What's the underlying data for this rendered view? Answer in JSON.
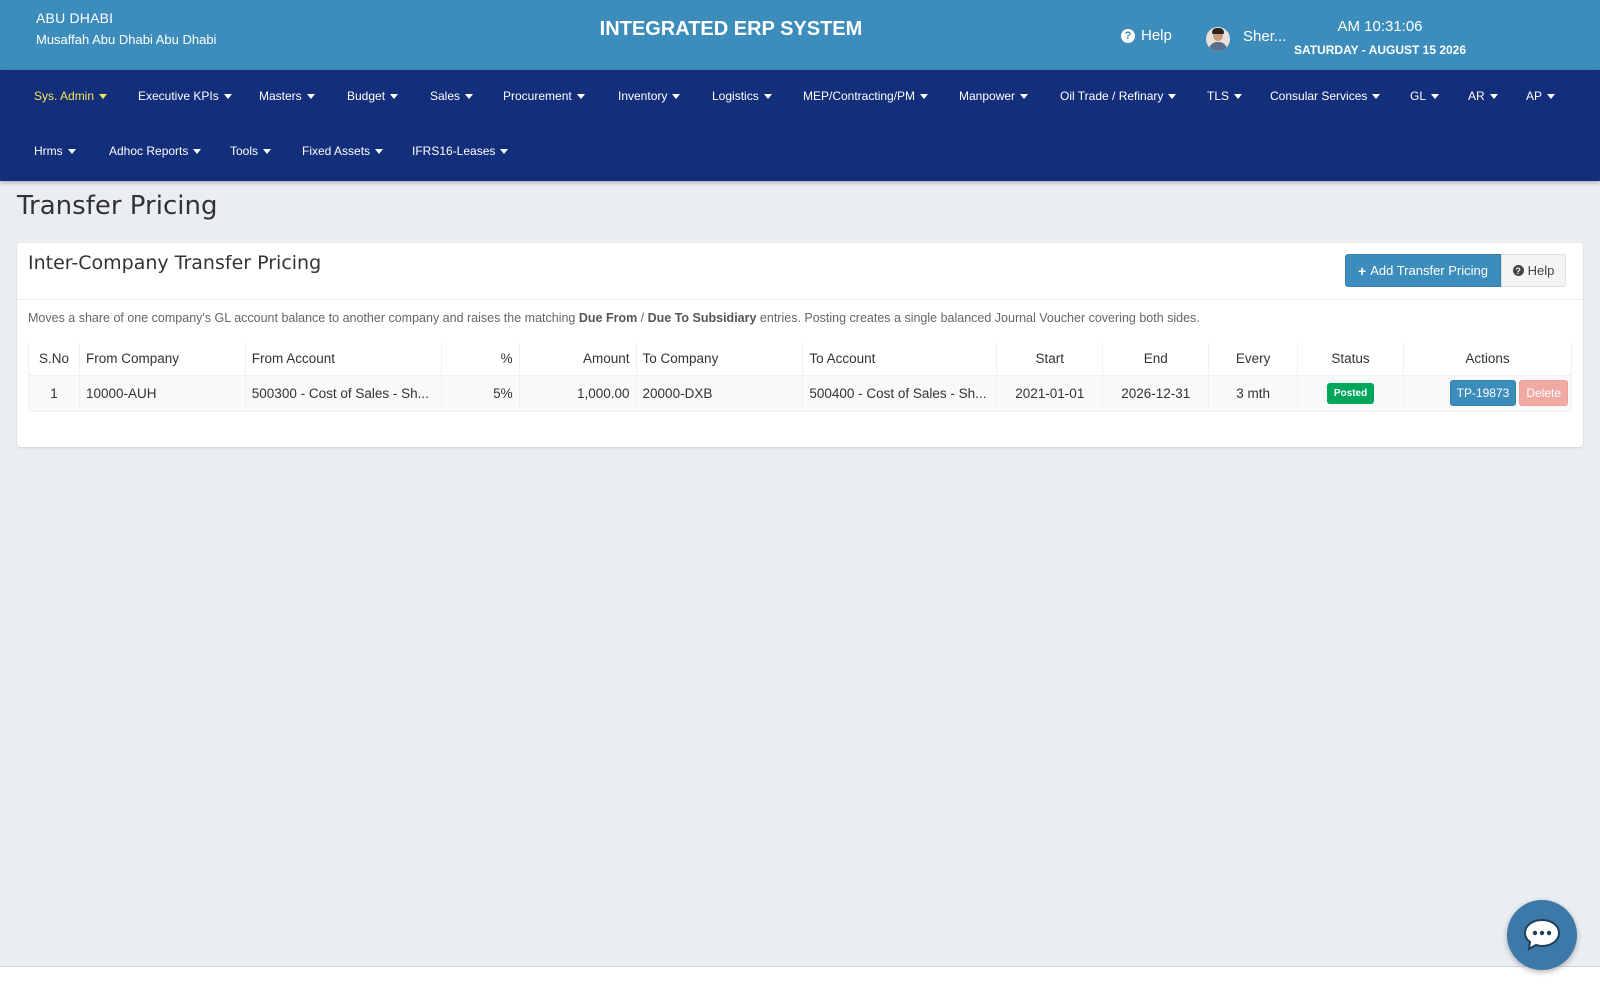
{
  "header": {
    "org_name": "ABU DHABI",
    "org_address": "Musaffah Abu Dhabi Abu Dhabi",
    "system_title": "INTEGRATED ERP SYSTEM",
    "help_label": "Help",
    "user_name": "Sher...",
    "clock_time": "AM 10:31:06",
    "clock_date": "SATURDAY - AUGUST 15 2026"
  },
  "nav": {
    "items": [
      {
        "label": "Sys. Admin",
        "active": true
      },
      {
        "label": "Executive KPIs"
      },
      {
        "label": "Masters"
      },
      {
        "label": "Budget"
      },
      {
        "label": "Sales"
      },
      {
        "label": "Procurement"
      },
      {
        "label": "Inventory"
      },
      {
        "label": "Logistics"
      },
      {
        "label": "MEP/Contracting/PM"
      },
      {
        "label": "Manpower"
      },
      {
        "label": "Oil Trade / Refinary"
      },
      {
        "label": "TLS"
      },
      {
        "label": "Consular Services"
      },
      {
        "label": "GL"
      },
      {
        "label": "AR"
      },
      {
        "label": "AP"
      },
      {
        "label": "Hrms"
      },
      {
        "label": "Adhoc Reports"
      },
      {
        "label": "Tools"
      },
      {
        "label": "Fixed Assets"
      },
      {
        "label": "IFRS16-Leases"
      }
    ]
  },
  "page": {
    "title": "Transfer Pricing",
    "card_title": "Inter-Company Transfer Pricing",
    "add_button_label": "Add Transfer Pricing",
    "help_button_label": "Help",
    "description": {
      "prefix": "Moves a share of one company's GL account balance to another company and raises the matching ",
      "bold_1": "Due From",
      "separator": " / ",
      "bold_2": "Due To Subsidiary",
      "suffix": " entries. Posting creates a single balanced Journal Voucher covering both sides."
    }
  },
  "table": {
    "headers": [
      "S.No",
      "From Company",
      "From Account",
      "%",
      "Amount",
      "To Company",
      "To Account",
      "Start",
      "End",
      "Every",
      "Status",
      "Actions"
    ],
    "rows": [
      {
        "sno": "1",
        "from_company": "10000-AUH",
        "from_account": "500300 - Cost of Sales - Sh...",
        "percent": "5%",
        "amount": "1,000.00",
        "to_company": "20000-DXB",
        "to_account": "500400 - Cost of Sales - Sh...",
        "start": "2021-01-01",
        "end": "2026-12-31",
        "every": "3 mth",
        "status": "Posted",
        "voucher": "TP-19873",
        "delete_label": "Delete"
      }
    ]
  },
  "colors": {
    "header_bg": "#3c8dbc",
    "navbar_bg": "#132e7a",
    "active_nav": "#f5e55a",
    "status_posted": "#00a65a",
    "delete_button": "#f0a9a3"
  }
}
